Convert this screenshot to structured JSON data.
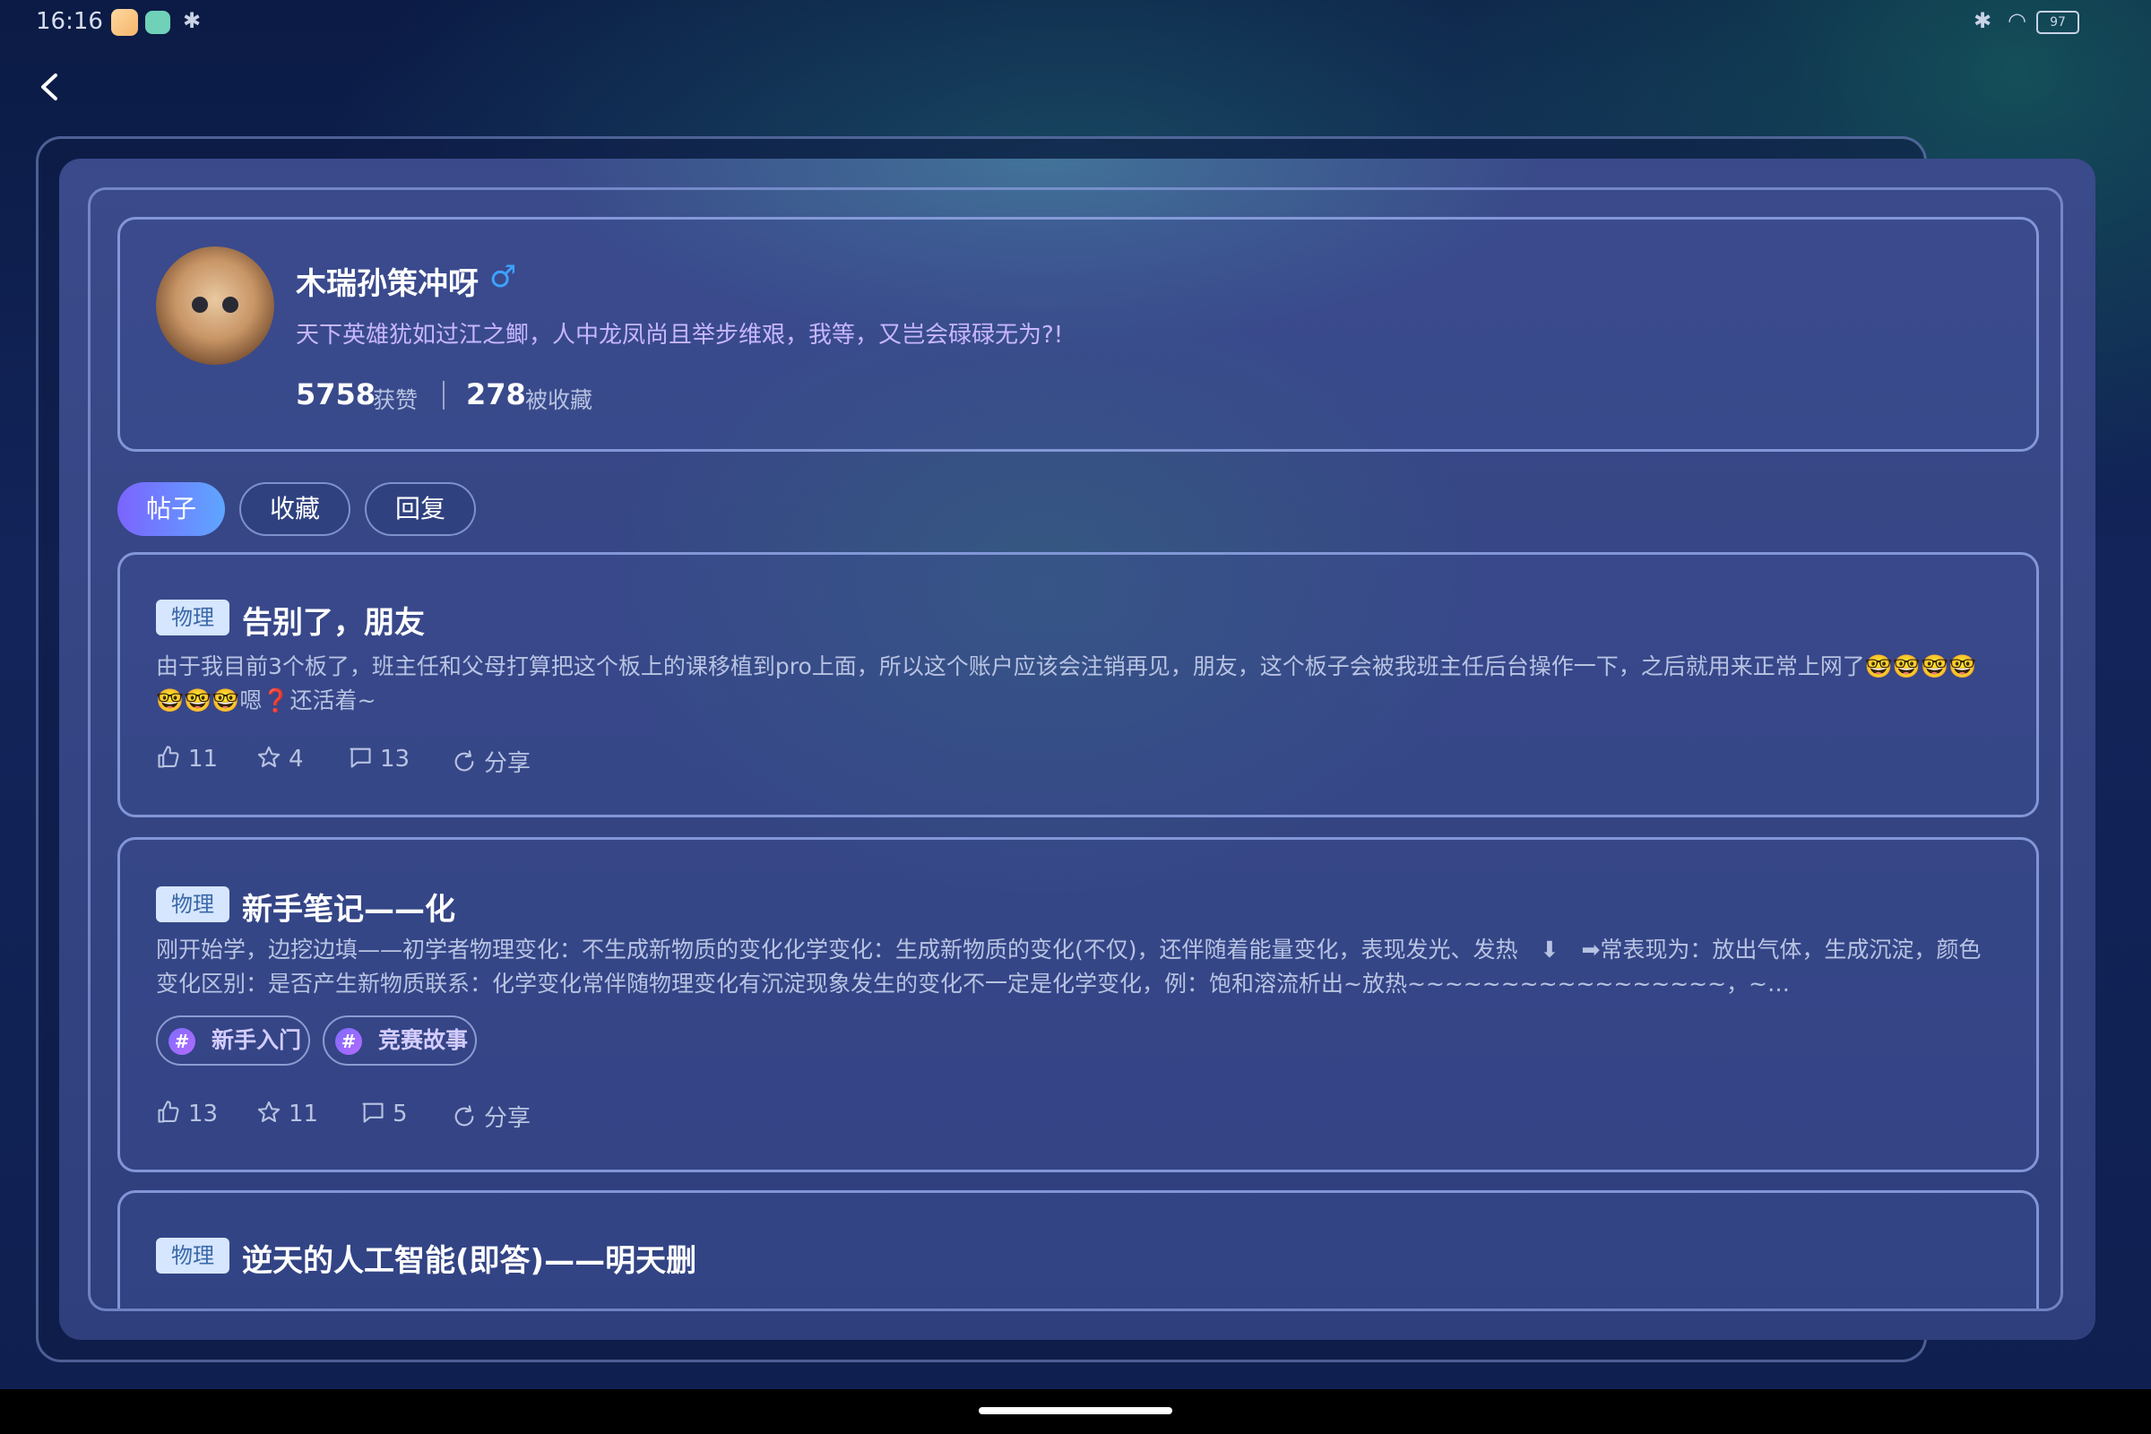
{
  "status_bar": {
    "time": "16:16",
    "battery": "97"
  },
  "profile": {
    "username": "木瑞孙策冲呀",
    "gender_symbol": "♂",
    "bio": "天下英雄犹如过江之鲫，人中龙凤尚且举步维艰，我等，又岂会碌碌无为?!",
    "likes_count": "5758",
    "likes_label": "获赞",
    "favorites_count": "278",
    "favorites_label": "被收藏"
  },
  "tabs": [
    {
      "label": "帖子",
      "active": true
    },
    {
      "label": "收藏",
      "active": false
    },
    {
      "label": "回复",
      "active": false
    }
  ],
  "posts": [
    {
      "category": "物理",
      "title": "告别了，朋友",
      "body": "由于我目前3个板了，班主任和父母打算把这个板上的课移植到pro上面，所以这个账户应该会注销再见，朋友，这个板子会被我班主任后台操作一下，之后就用来正常上网了🤓🤓🤓🤓🤓🤓🤓嗯❓还活着~",
      "likes": "11",
      "stars": "4",
      "comments": "13",
      "share_label": "分享"
    },
    {
      "category": "物理",
      "title": "新手笔记——化",
      "body": "刚开始学，边挖边填——初学者物理变化：不生成新物质的变化化学变化：生成新物质的变化(不仅)，还伴随着能量变化，表现发光、发热　⬇　➡常表现为：放出气体，生成沉淀，颜色变化区别：是否产生新物质联系：化学变化常伴随物理变化有沉淀现象发生的变化不一定是化学变化，例：饱和溶流析出~放热~~~~~~~~~~~~~~~~~，~…",
      "tags": [
        "新手入门",
        "竞赛故事"
      ],
      "likes": "13",
      "stars": "11",
      "comments": "5",
      "share_label": "分享"
    },
    {
      "category": "物理",
      "title": "逆天的人工智能(即答)——明天删"
    }
  ]
}
